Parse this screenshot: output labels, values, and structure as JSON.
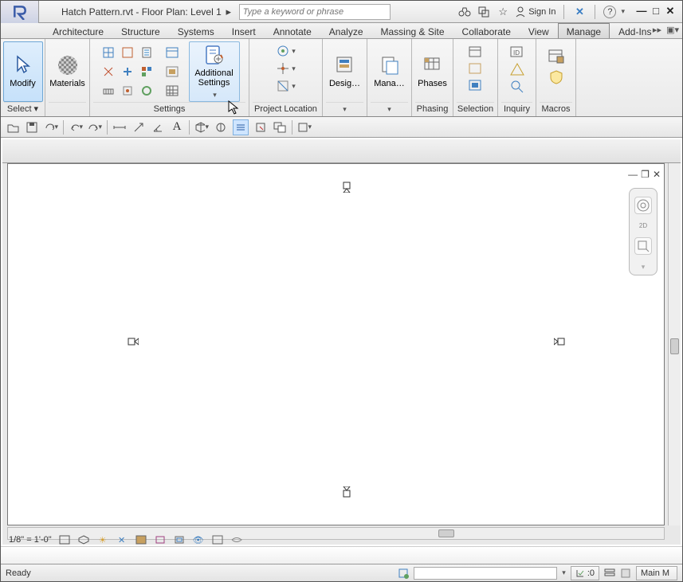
{
  "title": "Hatch Pattern.rvt - Floor Plan: Level 1",
  "search_placeholder": "Type a keyword or phrase",
  "signin": "Sign In",
  "tabs": [
    "Architecture",
    "Structure",
    "Systems",
    "Insert",
    "Annotate",
    "Analyze",
    "Massing & Site",
    "Collaborate",
    "View",
    "Manage",
    "Add-Ins"
  ],
  "active_tab": "Manage",
  "ribbon": {
    "select": {
      "modify": "Modify",
      "label": "Select ▾"
    },
    "materials": "Materials",
    "settings_label": "Settings",
    "additional_settings": "Additional Settings",
    "project_location": "Project Location",
    "design": "Desig…",
    "manage": "Mana…",
    "phases": "Phases",
    "phasing": "Phasing",
    "selection": "Selection",
    "inquiry": "Inquiry",
    "macros": "Macros"
  },
  "view_controls": [
    "—",
    "❐",
    "✕"
  ],
  "nav": {
    "twod": "2D"
  },
  "scale": "1/8\" = 1'-0\"",
  "status": {
    "ready": "Ready",
    "zero": ":0",
    "model": "Main M"
  },
  "colors": {
    "accent_blue": "#4a7bc4",
    "hover_border": "#6ea7d6"
  }
}
